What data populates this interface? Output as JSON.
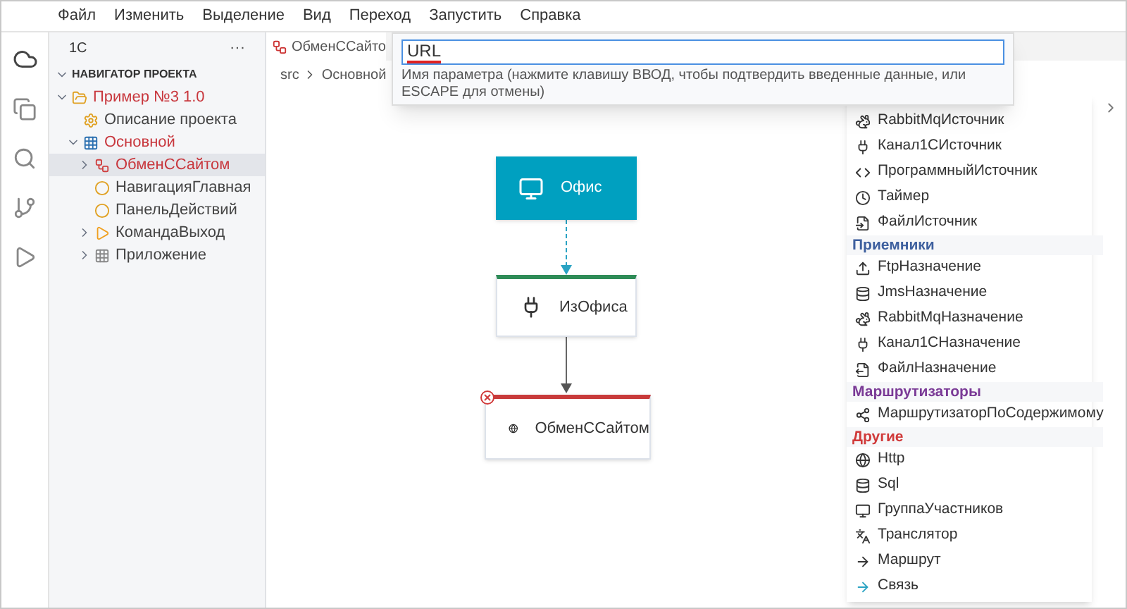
{
  "menu": [
    "Файл",
    "Изменить",
    "Выделение",
    "Вид",
    "Переход",
    "Запустить",
    "Справка"
  ],
  "sidebar": {
    "title": "1C",
    "more": "···",
    "section": {
      "label": "НАВИГАТОР ПРОЕКТА",
      "expanded": true
    },
    "tree": [
      {
        "label": "Пример №3 1.0",
        "modified": true,
        "expanded": true,
        "selected": false,
        "children": [
          {
            "label": "Описание проекта",
            "modified": false,
            "selected": false
          },
          {
            "label": "Основной",
            "modified": true,
            "expanded": true,
            "selected": false,
            "children": [
              {
                "label": "ОбменССайтом",
                "modified": true,
                "expanded": false,
                "selected": true
              },
              {
                "label": "НавигацияГлавная",
                "modified": false,
                "selected": false
              },
              {
                "label": "ПанельДействий",
                "modified": false,
                "selected": false
              },
              {
                "label": "КомандаВыход",
                "modified": false,
                "expanded": false,
                "selected": false
              },
              {
                "label": "Приложение",
                "modified": false,
                "expanded": false,
                "selected": false
              }
            ]
          }
        ]
      }
    ]
  },
  "editor": {
    "tab": "ОбменССайто",
    "breadcrumb": [
      "src",
      "Основной"
    ]
  },
  "quick_input": {
    "value": "URL",
    "message": "Имя параметра (нажмите клавишу ВВОД, чтобы подтвердить введенные данные, или ESCAPE для отмены)"
  },
  "diagram": {
    "nodes": [
      {
        "label": "Офис",
        "kind": "participants"
      },
      {
        "label": "ИзОфиса",
        "kind": "channel"
      },
      {
        "label": "ОбменССайтом",
        "kind": "http",
        "error": true
      }
    ]
  },
  "palette": {
    "groups": [
      {
        "items": [
          "RabbitMqИсточник",
          "Канал1CИсточник",
          "ПрограммныйИсточник",
          "Таймер",
          "ФайлИсточник"
        ]
      },
      {
        "title": "Приемники",
        "color": "#3d5f9e",
        "items": [
          "FtpНазначение",
          "JmsНазначение",
          "RabbitMqНазначение",
          "Канал1CНазначение",
          "ФайлНазначение"
        ]
      },
      {
        "title": "Маршрутизаторы",
        "color": "#7a3a96",
        "items": [
          "МаршрутизаторПоСодержимому"
        ]
      },
      {
        "title": "Другие",
        "color": "#d03a3a",
        "items": [
          "Http",
          "Sql",
          "ГруппаУчастников",
          "Транслятор",
          "Маршрут",
          "Связь"
        ]
      }
    ]
  }
}
